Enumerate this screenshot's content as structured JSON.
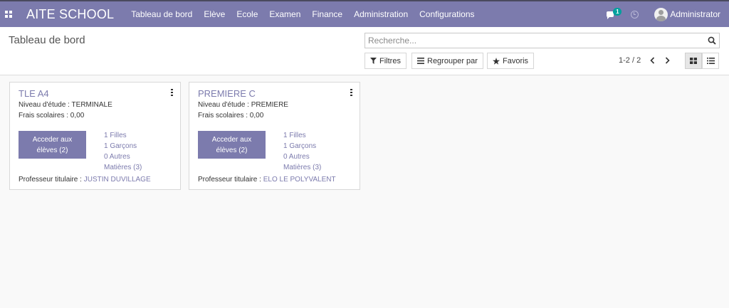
{
  "navbar": {
    "brand": "AITE SCHOOL",
    "menu": [
      "Tableau de bord",
      "Elève",
      "Ecole",
      "Examen",
      "Finance",
      "Administration",
      "Configurations"
    ],
    "messages_badge": "1",
    "user": "Administrator",
    "icons": {
      "apps": "apps-grid-icon",
      "chat": "chat-icon",
      "activity": "clock-icon",
      "avatar": "user-avatar"
    }
  },
  "control": {
    "title": "Tableau de bord",
    "search_placeholder": "Recherche...",
    "filters_label": "Filtres",
    "group_label": "Regrouper par",
    "favorites_label": "Favoris",
    "pager": "1-2 / 2"
  },
  "cards": [
    {
      "title": "TLE A4",
      "niveau": "Niveau d'étude : TERMINALE",
      "frais": "Frais scolaires : 0,00",
      "btn_line1": "Acceder aux",
      "btn_line2": "élèves (2)",
      "filles": "1 Filles",
      "garcons": "1 Garçons",
      "autres": "0 Autres",
      "matieres": "Matières (3)",
      "prof_label": "Professeur titulaire : ",
      "prof_name": "JUSTIN DUVILLAGE"
    },
    {
      "title": "PREMIERE C",
      "niveau": "Niveau d'étude : PREMIERE",
      "frais": "Frais scolaires : 0,00",
      "btn_line1": "Acceder aux",
      "btn_line2": "élèves (2)",
      "filles": "1 Filles",
      "garcons": "1 Garçons",
      "autres": "0 Autres",
      "matieres": "Matières (3)",
      "prof_label": "Professeur titulaire : ",
      "prof_name": "ELO LE POLYVALENT"
    }
  ],
  "colors": {
    "primary": "#7c7bad",
    "badge": "#00a09d"
  }
}
